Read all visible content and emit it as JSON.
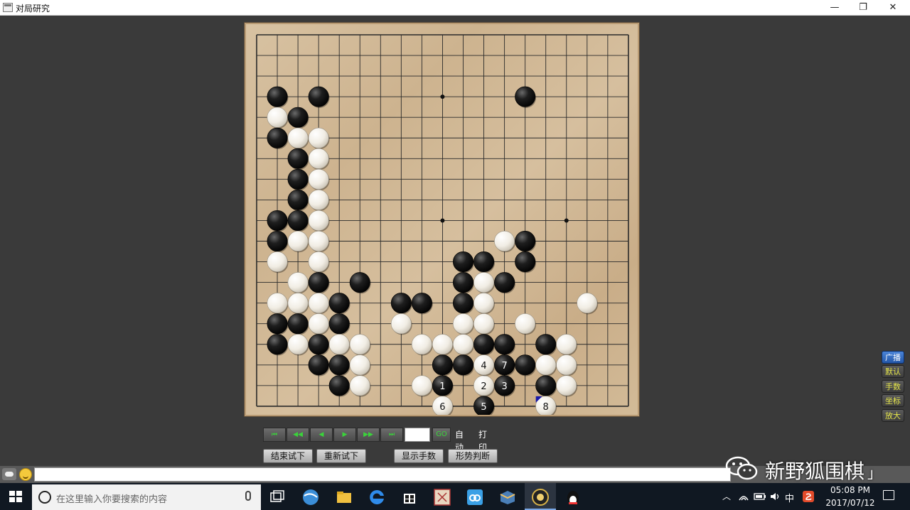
{
  "window": {
    "title": "对局研究",
    "minimize_label": "—",
    "maximize_label": "❐",
    "close_label": "✕"
  },
  "board": {
    "size": 19,
    "star_points": [
      [
        9,
        3
      ],
      [
        3,
        9
      ],
      [
        9,
        9
      ],
      [
        15,
        9
      ]
    ],
    "black_stones": [
      [
        1,
        3
      ],
      [
        3,
        3
      ],
      [
        13,
        3
      ],
      [
        2,
        4
      ],
      [
        1,
        5
      ],
      [
        2,
        6
      ],
      [
        2,
        7
      ],
      [
        2,
        8
      ],
      [
        1,
        9
      ],
      [
        2,
        9
      ],
      [
        1,
        10
      ],
      [
        10,
        11
      ],
      [
        11,
        11
      ],
      [
        13,
        10
      ],
      [
        13,
        11
      ],
      [
        3,
        12
      ],
      [
        5,
        12
      ],
      [
        10,
        12
      ],
      [
        12,
        12
      ],
      [
        4,
        13
      ],
      [
        7,
        13
      ],
      [
        8,
        13
      ],
      [
        10,
        13
      ],
      [
        1,
        14
      ],
      [
        2,
        14
      ],
      [
        4,
        14
      ],
      [
        1,
        15
      ],
      [
        3,
        15
      ],
      [
        11,
        15
      ],
      [
        12,
        15
      ],
      [
        14,
        15
      ],
      [
        3,
        16
      ],
      [
        4,
        16
      ],
      [
        9,
        16
      ],
      [
        10,
        16
      ],
      [
        13,
        16
      ],
      [
        4,
        17
      ],
      [
        14,
        17
      ]
    ],
    "white_stones": [
      [
        1,
        4
      ],
      [
        2,
        5
      ],
      [
        3,
        5
      ],
      [
        3,
        6
      ],
      [
        3,
        7
      ],
      [
        3,
        8
      ],
      [
        3,
        9
      ],
      [
        2,
        10
      ],
      [
        3,
        10
      ],
      [
        1,
        11
      ],
      [
        3,
        11
      ],
      [
        12,
        10
      ],
      [
        2,
        12
      ],
      [
        11,
        12
      ],
      [
        1,
        13
      ],
      [
        2,
        13
      ],
      [
        3,
        13
      ],
      [
        11,
        13
      ],
      [
        16,
        13
      ],
      [
        3,
        14
      ],
      [
        7,
        14
      ],
      [
        10,
        14
      ],
      [
        11,
        14
      ],
      [
        13,
        14
      ],
      [
        2,
        15
      ],
      [
        4,
        15
      ],
      [
        5,
        15
      ],
      [
        8,
        15
      ],
      [
        9,
        15
      ],
      [
        10,
        15
      ],
      [
        15,
        15
      ],
      [
        5,
        16
      ],
      [
        14,
        16
      ],
      [
        15,
        16
      ],
      [
        5,
        17
      ],
      [
        8,
        17
      ],
      [
        15,
        17
      ]
    ],
    "numbered_moves": [
      {
        "n": "1",
        "color": "black",
        "x": 9,
        "y": 17
      },
      {
        "n": "2",
        "color": "white",
        "x": 11,
        "y": 17
      },
      {
        "n": "3",
        "color": "black",
        "x": 12,
        "y": 17
      },
      {
        "n": "4",
        "color": "white",
        "x": 11,
        "y": 16
      },
      {
        "n": "5",
        "color": "black",
        "x": 11,
        "y": 18
      },
      {
        "n": "6",
        "color": "white",
        "x": 9,
        "y": 18
      },
      {
        "n": "7",
        "color": "black",
        "x": 12,
        "y": 16
      },
      {
        "n": "8",
        "color": "white",
        "x": 14,
        "y": 18
      }
    ],
    "last_move_marker_color": "#1a1aa8"
  },
  "controls": {
    "first": "⏮",
    "fast_back": "◀◀",
    "back": "◀",
    "forward": "▶",
    "fast_forward": "▶▶",
    "last": "⏭",
    "move_value": "",
    "go": "GO",
    "auto": "自动",
    "print": "打印"
  },
  "actions": {
    "end_trial": "结束试下",
    "restart_trial": "重新试下",
    "show_move_numbers": "显示手数",
    "judge_position": "形势判断"
  },
  "side_buttons": [
    {
      "label": "广播",
      "active": true
    },
    {
      "label": "默认",
      "active": false
    },
    {
      "label": "手数",
      "active": false
    },
    {
      "label": "坐标",
      "active": false
    },
    {
      "label": "放大",
      "active": false
    }
  ],
  "chat": {
    "value": ""
  },
  "watermark": {
    "text": "新野狐围棋",
    "tail": "」"
  },
  "taskbar": {
    "search_placeholder": "在这里输入你要搜索的内容",
    "ime": "中",
    "time": "05:08 PM",
    "date": "2017/07/12"
  },
  "colors": {
    "board_line": "#2a2a2a",
    "black_stone": "#161616",
    "white_stone": "#f3efe6",
    "accent_green": "#3ad43a",
    "side_text": "#e6e64a"
  }
}
